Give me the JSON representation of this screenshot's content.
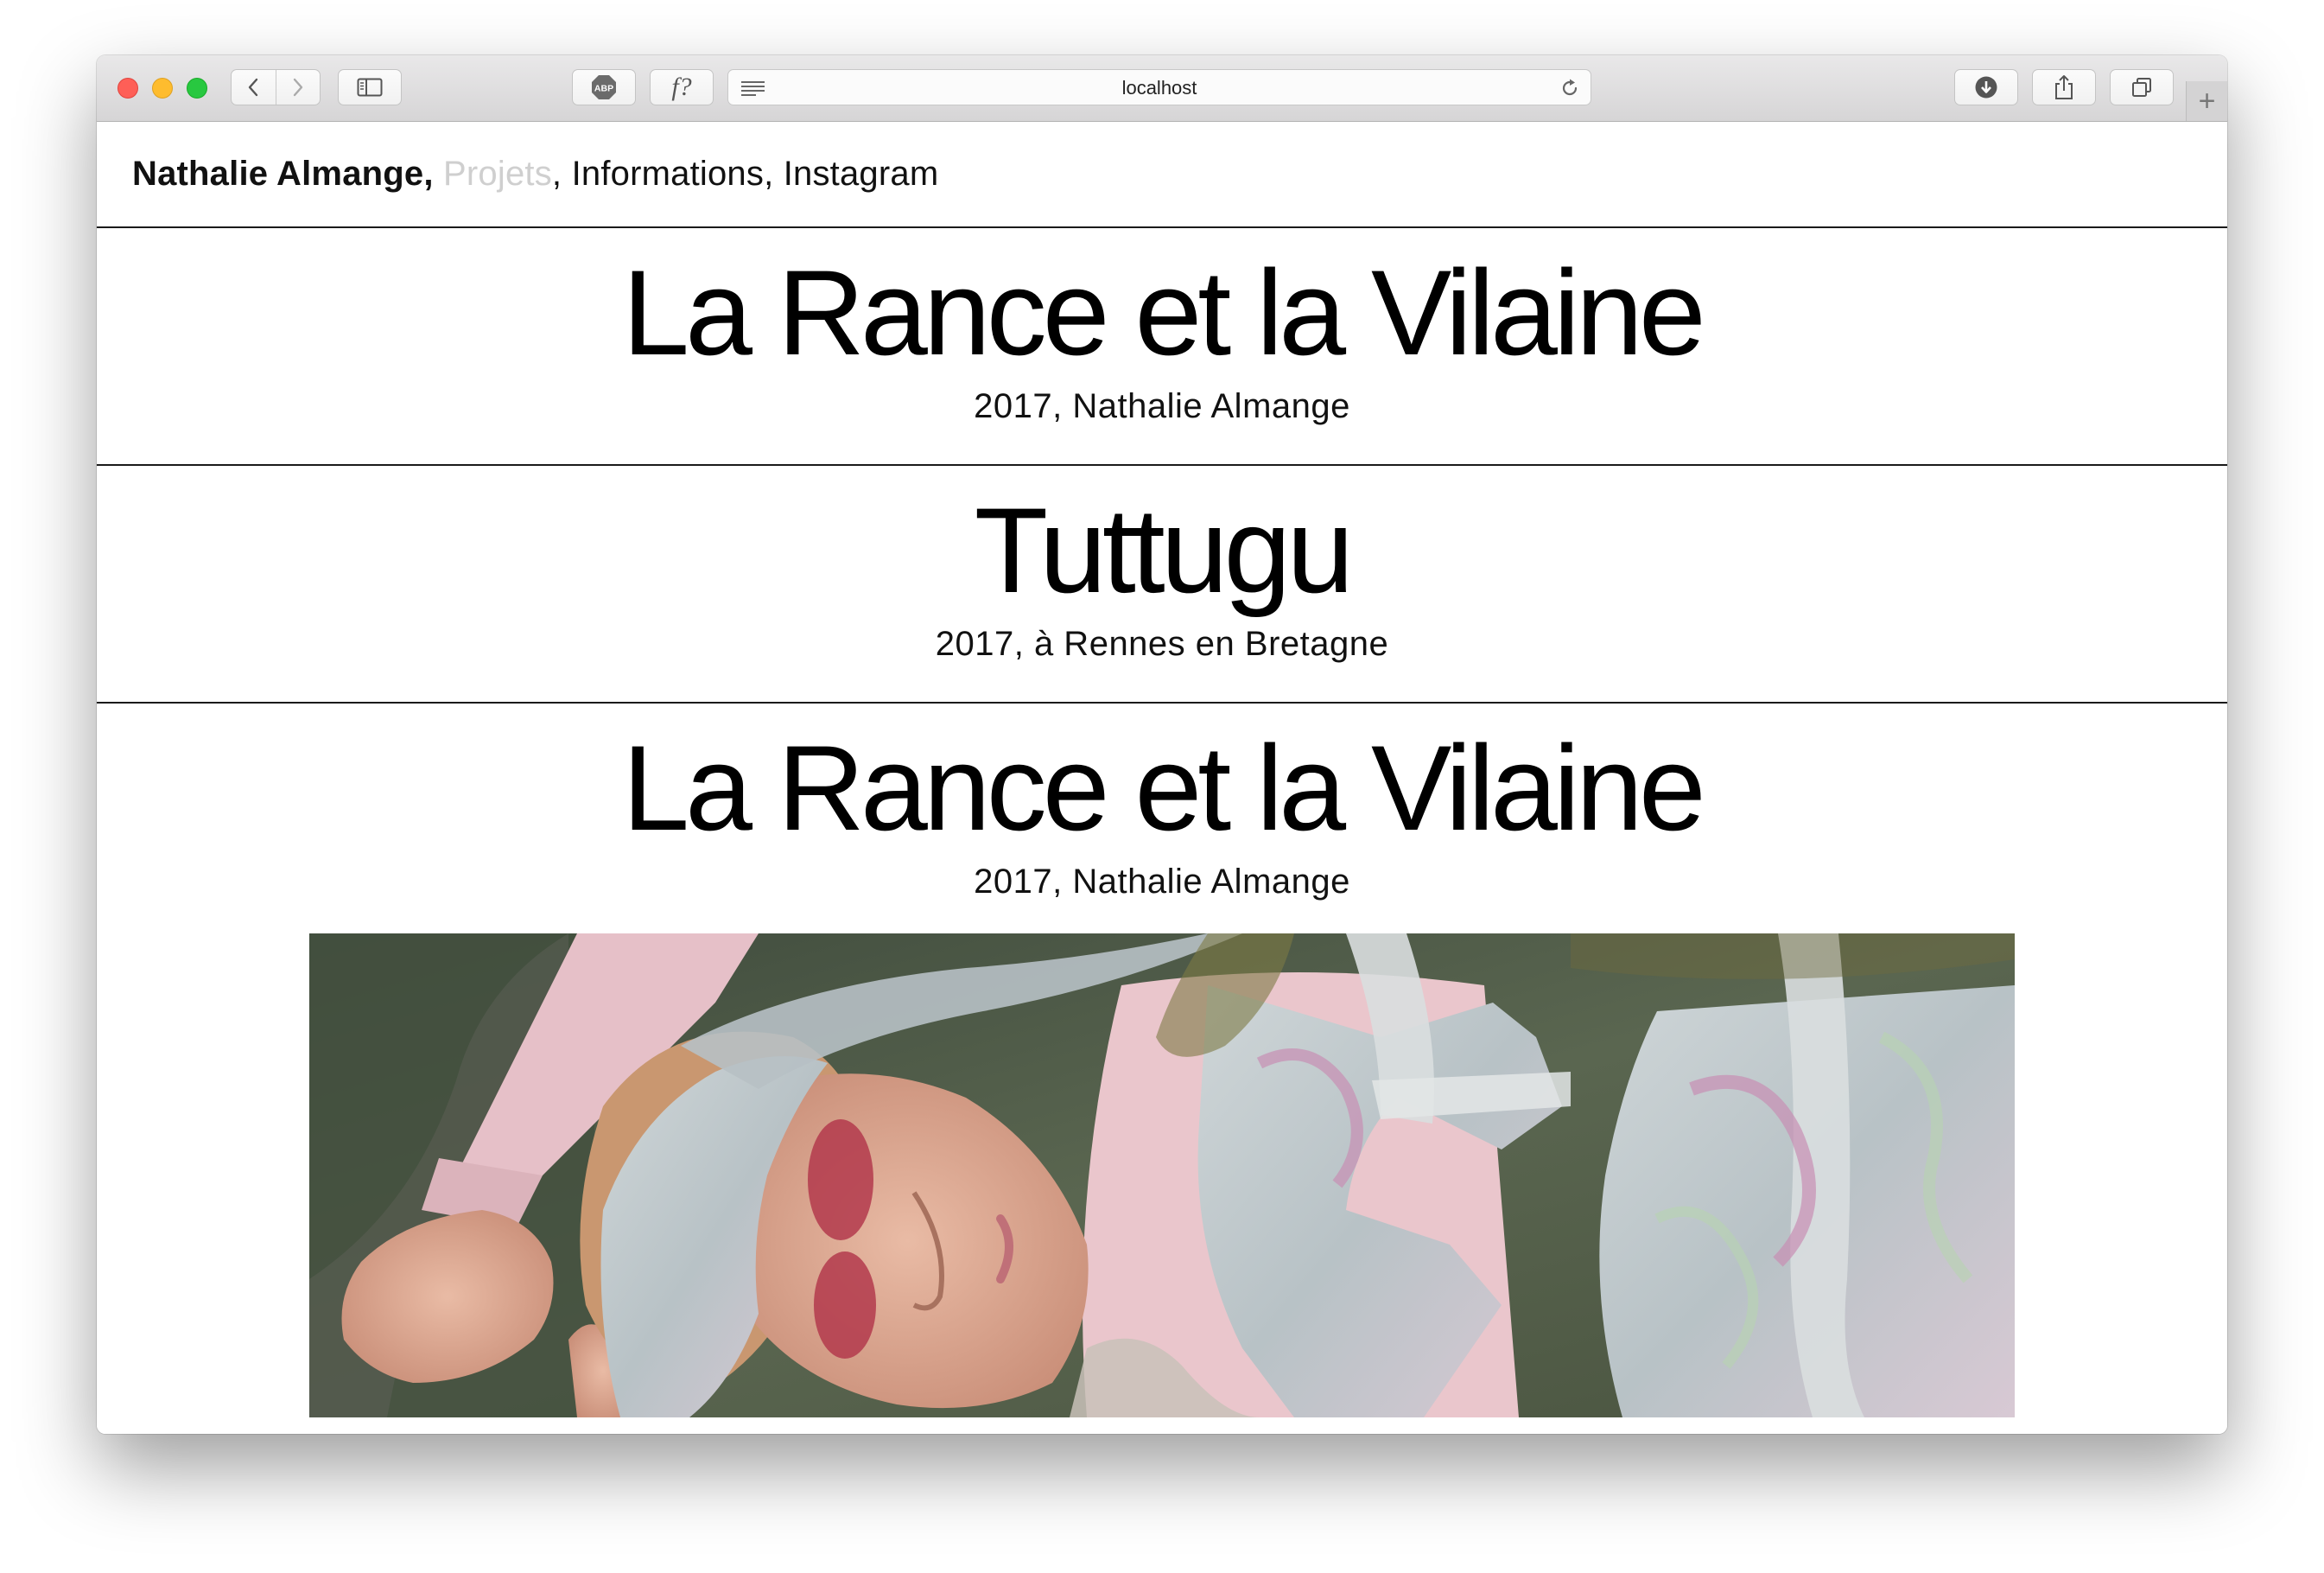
{
  "browser": {
    "url": "localhost",
    "toolbar_icons": [
      "back-icon",
      "forward-icon",
      "sidebar-icon",
      "adblock-icon",
      "font-icon",
      "reader-icon",
      "reload-icon",
      "download-icon",
      "share-icon",
      "tabs-icon",
      "plus-icon"
    ],
    "adblock_label": "ABP",
    "font_label": "f?",
    "new_tab_label": "+"
  },
  "site": {
    "brand": "Nathalie Almange,",
    "nav": {
      "projets": "Projets",
      "sep1": ",",
      "informations": "Informations,",
      "instagram": "Instagram"
    }
  },
  "projects": [
    {
      "title": "La Rance et la Vilaine",
      "meta": "2017, Nathalie Almange"
    },
    {
      "title": "Tuttugu",
      "meta": "2017, à Rennes en Bretagne"
    },
    {
      "title": "La Rance et la Vilaine",
      "meta": "2017, Nathalie Almange"
    }
  ],
  "colors": {
    "close": "#fe5f57",
    "minimize": "#febc2e",
    "zoom": "#28c840",
    "nav_muted": "#cfcfcf",
    "rule": "#1a1a1a"
  }
}
